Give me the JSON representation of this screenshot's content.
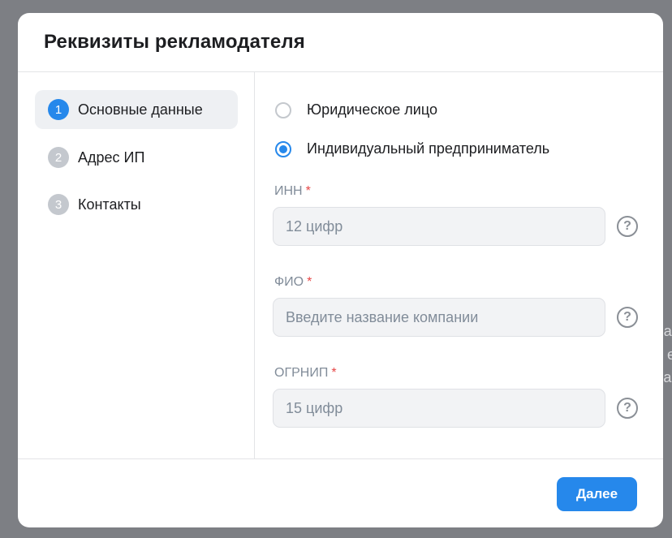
{
  "background": {
    "peek_lines": [
      "па",
      "е",
      "ва"
    ]
  },
  "dialog": {
    "title": "Реквизиты рекламодателя"
  },
  "steps": [
    {
      "number": "1",
      "label": "Основные данные",
      "active": true
    },
    {
      "number": "2",
      "label": "Адрес ИП",
      "active": false
    },
    {
      "number": "3",
      "label": "Контакты",
      "active": false
    }
  ],
  "entity_type": {
    "options": [
      {
        "label": "Юридическое лицо",
        "selected": false
      },
      {
        "label": "Индивидуальный предприниматель",
        "selected": true
      }
    ]
  },
  "fields": [
    {
      "label": "ИНН",
      "required_mark": "*",
      "value": "",
      "placeholder": "12 цифр"
    },
    {
      "label": "ФИО",
      "required_mark": "*",
      "value": "",
      "placeholder": "Введите название компании"
    },
    {
      "label": "ОГРНИП",
      "required_mark": "*",
      "value": "",
      "placeholder": "15 цифр"
    }
  ],
  "help_icon_glyph": "?",
  "footer": {
    "next_label": "Далее"
  },
  "colors": {
    "accent": "#2688eb",
    "required": "#e64646",
    "overlay": "#7d7f84"
  },
  "icons": [
    "radio-unchecked-icon",
    "radio-checked-icon",
    "question-circle-icon"
  ]
}
